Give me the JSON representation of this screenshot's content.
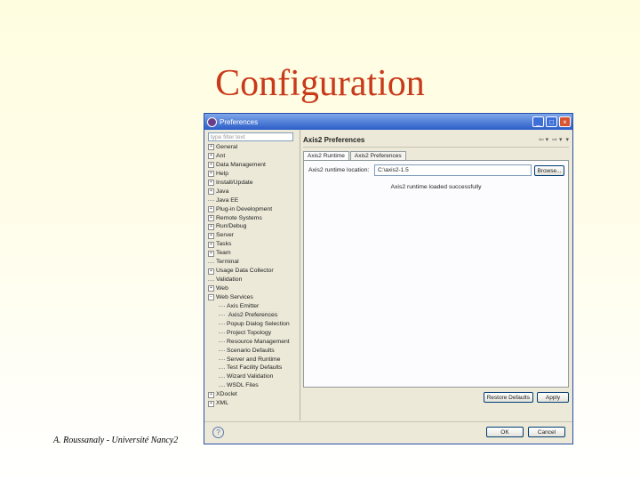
{
  "slide": {
    "title": "Configuration",
    "footer": "A. Roussanaly - Université Nancy2"
  },
  "window": {
    "title": "Preferences",
    "controls": {
      "minimize": "_",
      "maximize": "□",
      "close": "×"
    }
  },
  "left": {
    "filter_placeholder": "type filter text",
    "tree": [
      {
        "label": "General",
        "expandable": true
      },
      {
        "label": "Ant",
        "expandable": true
      },
      {
        "label": "Data Management",
        "expandable": true
      },
      {
        "label": "Help",
        "expandable": true
      },
      {
        "label": "Install/Update",
        "expandable": true
      },
      {
        "label": "Java",
        "expandable": true
      },
      {
        "label": "Java EE",
        "expandable": false
      },
      {
        "label": "Plug-in Development",
        "expandable": true
      },
      {
        "label": "Remote Systems",
        "expandable": true
      },
      {
        "label": "Run/Debug",
        "expandable": true
      },
      {
        "label": "Server",
        "expandable": true
      },
      {
        "label": "Tasks",
        "expandable": true
      },
      {
        "label": "Team",
        "expandable": true
      },
      {
        "label": "Terminal",
        "expandable": false
      },
      {
        "label": "Usage Data Collector",
        "expandable": true
      },
      {
        "label": "Validation",
        "expandable": false
      },
      {
        "label": "Web",
        "expandable": true
      },
      {
        "label": "Web Services",
        "expandable": true,
        "expanded": true
      },
      {
        "label": "Axis Emitter",
        "child": true
      },
      {
        "label": "Axis2 Preferences",
        "child": true,
        "selected": true
      },
      {
        "label": "Popup Dialog Selection",
        "child": true
      },
      {
        "label": "Project Topology",
        "child": true
      },
      {
        "label": "Resource Management",
        "child": true
      },
      {
        "label": "Scenario Defaults",
        "child": true
      },
      {
        "label": "Server and Runtime",
        "child": true
      },
      {
        "label": "Test Facility Defaults",
        "child": true
      },
      {
        "label": "Wizard Validation",
        "child": true
      },
      {
        "label": "WSDL Files",
        "child": true
      },
      {
        "label": "XDoclet",
        "expandable": true
      },
      {
        "label": "XML",
        "expandable": true
      }
    ]
  },
  "right": {
    "title": "Axis2 Preferences",
    "nav": {
      "back": "⇦ ▾",
      "forward": "⇨ ▾",
      "menu": "▾"
    },
    "tabs": [
      "Axis2 Runtime",
      "Axis2 Preferences"
    ],
    "runtime_label": "Axis2 runtime location:",
    "runtime_value": "C:\\axis2-1.5",
    "browse_label": "Browse...",
    "status": "Axis2 runtime loaded successfully",
    "restore_label": "Restore Defaults",
    "apply_label": "Apply"
  },
  "bottom": {
    "help_icon": "?",
    "ok_label": "OK",
    "cancel_label": "Cancel"
  }
}
